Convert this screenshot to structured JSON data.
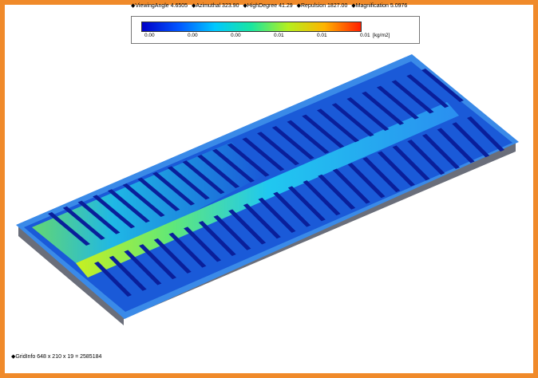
{
  "header": {
    "viewing_angle": "◆ViewingAngle 4.6505",
    "azimuthal": "◆Azimuthal 323.90",
    "high_degree": "◆HighDegree 41.29",
    "repulsion": "◆Repulsion 1827.00",
    "magnification": "◆Magnification 5.0976"
  },
  "legend": {
    "ticks": [
      "0.00",
      "0.00",
      "0.00",
      "0.01",
      "0.01",
      "0.01"
    ],
    "unit": "[kg/m2]",
    "colors": [
      "#0000c8",
      "#0055ff",
      "#00c8ff",
      "#19e6a0",
      "#b4f01e",
      "#ffb400",
      "#ff1e00"
    ]
  },
  "footer": {
    "grid_info": "◆GridInfo 648 x 210 x 19 = 2585184"
  },
  "colors": {
    "frame": "#f08a2a",
    "floor": "#1a5ad8",
    "rack": "#0a1f9a",
    "rim": "#3a8ae8",
    "wall": "#6a6e7a"
  }
}
